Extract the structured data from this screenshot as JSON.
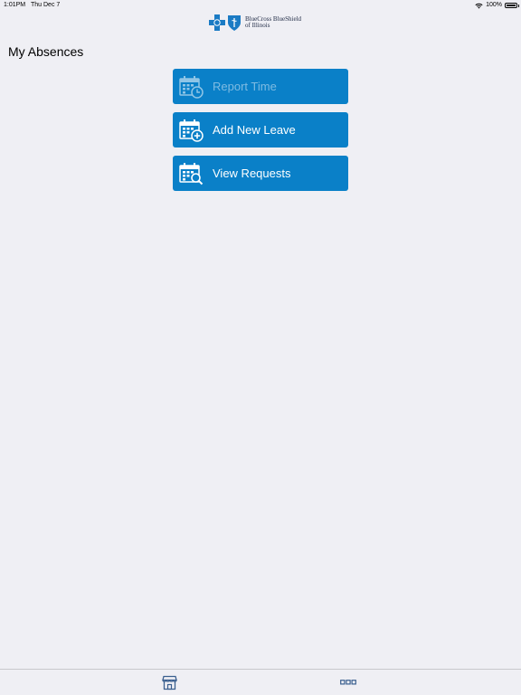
{
  "status_bar": {
    "time": "1:01PM",
    "date": "Thu Dec 7",
    "battery": "100%"
  },
  "header": {
    "logo_line1": "BlueCross BlueShield",
    "logo_line2": "of Illinois"
  },
  "page": {
    "title": "My Absences"
  },
  "menu": {
    "items": [
      {
        "label": "Report Time",
        "icon": "calendar-clock-icon",
        "enabled": false
      },
      {
        "label": "Add New Leave",
        "icon": "calendar-add-icon",
        "enabled": true
      },
      {
        "label": "View Requests",
        "icon": "calendar-search-icon",
        "enabled": true
      }
    ]
  },
  "tab_bar": {
    "tabs": [
      {
        "icon": "store-icon"
      },
      {
        "icon": "more-icon"
      }
    ]
  },
  "colors": {
    "background": "#efeff4",
    "button": "#0a80c8",
    "button_disabled_text": "#7fbbe2",
    "tab_icon": "#3a5f8f"
  }
}
